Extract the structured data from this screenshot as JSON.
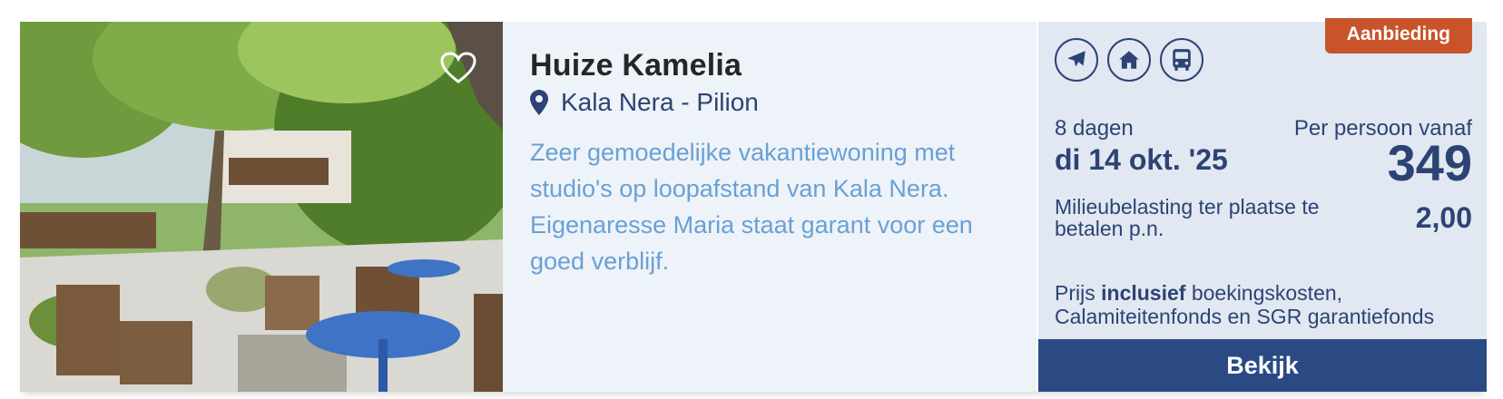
{
  "hotel": {
    "name": "Huize Kamelia",
    "location": "Kala Nera - Pilion",
    "description": "Zeer gemoedelijke vakantiewoning met studio's op loopafstand van Kala Nera. Eigenaresse Maria staat garant voor een goed verblijf."
  },
  "icons": {
    "favorite": "heart-outline-icon",
    "location": "map-pin-icon",
    "transport": [
      "airplane-icon",
      "house-icon",
      "bus-icon"
    ]
  },
  "offer": {
    "badge": "Aanbieding",
    "duration": "8 dagen",
    "date": "di 14 okt. '25",
    "price_label": "Per persoon vanaf",
    "price": "349",
    "tax_label": "Milieubelasting ter plaatse te betalen p.n.",
    "tax_value": "2,00",
    "incl_prefix": "Prijs ",
    "incl_bold": "inclusief",
    "incl_suffix": " boekingskosten, Calamiteitenfonds en SGR garantiefonds",
    "cta": "Bekijk"
  },
  "colors": {
    "navy": "#2d4373",
    "button": "#2b4a84",
    "badge": "#c9542b",
    "description": "#6aa0d4",
    "info_bg": "#eef3f9",
    "panel_bg": "#e1e8f2"
  }
}
